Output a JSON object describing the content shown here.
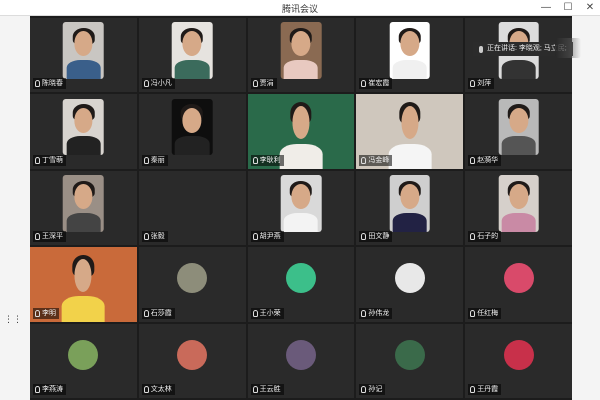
{
  "window": {
    "title": "腾讯会议",
    "controls": {
      "minimize": "—",
      "maximize": "☐",
      "close": "✕"
    }
  },
  "speaking_indicator": {
    "text": "正在讲话: 李晓观; 马立民;"
  },
  "side_control": {
    "label": "⋮⋮"
  },
  "participants": [
    {
      "name": "陈晓春",
      "kind": "camera",
      "bg": "#c9c6c2",
      "shirt": "#3a5f8a"
    },
    {
      "name": "冯小凡",
      "kind": "camera",
      "bg": "#e6e3df",
      "shirt": "#3b6b5c"
    },
    {
      "name": "贾涓",
      "kind": "camera",
      "bg": "#8a6a52",
      "shirt": "#e8c9c0"
    },
    {
      "name": "崔宏霞",
      "kind": "camera",
      "bg": "#ffffff",
      "shirt": "#f0f0f0"
    },
    {
      "name": "刘萍",
      "kind": "camera",
      "bg": "#dcdcdc",
      "shirt": "#333333"
    },
    {
      "name": "丁雪萌",
      "kind": "camera",
      "bg": "#d8d4cf",
      "shirt": "#222222"
    },
    {
      "name": "秦丽",
      "kind": "camera",
      "bg": "#0e0e0e",
      "shirt": "#222222"
    },
    {
      "name": "李耿利",
      "kind": "wide",
      "bg": "#2a6a4a",
      "shirt": "#f0ede8",
      "active": true
    },
    {
      "name": "冯金峰",
      "kind": "wide",
      "bg": "#cfc7bd",
      "shirt": "#f5f5f5"
    },
    {
      "name": "赵漪华",
      "kind": "camera",
      "bg": "#b9b9b9",
      "shirt": "#555555"
    },
    {
      "name": "王深平",
      "kind": "camera",
      "bg": "#9a8f86",
      "shirt": "#444444"
    },
    {
      "name": "张毅",
      "kind": "empty"
    },
    {
      "name": "胡尹燕",
      "kind": "camera",
      "bg": "#d9d9d9",
      "shirt": "#f3f3f3"
    },
    {
      "name": "田文静",
      "kind": "camera",
      "bg": "#cfcfcf",
      "shirt": "#222244"
    },
    {
      "name": "石子的",
      "kind": "camera",
      "bg": "#d6d0cb",
      "shirt": "#c98aa5"
    },
    {
      "name": "李明",
      "kind": "wide",
      "bg": "#c96a3a",
      "shirt": "#f2d24a"
    },
    {
      "name": "石莎霞",
      "kind": "avatar",
      "avatar": "#8d8d7a"
    },
    {
      "name": "王小荣",
      "kind": "avatar",
      "avatar": "#3cbf8a"
    },
    {
      "name": "孙伟龙",
      "kind": "avatar",
      "avatar": "#e8e8e8"
    },
    {
      "name": "任红梅",
      "kind": "avatar",
      "avatar": "#d94a6a"
    },
    {
      "name": "李燕涛",
      "kind": "avatar",
      "avatar": "#7aa05a"
    },
    {
      "name": "文太林",
      "kind": "avatar",
      "avatar": "#c96a5a"
    },
    {
      "name": "王云胜",
      "kind": "avatar",
      "avatar": "#6a5a7a"
    },
    {
      "name": "孙记",
      "kind": "avatar",
      "avatar": "#3a6a4a"
    },
    {
      "name": "王丹霞",
      "kind": "avatar",
      "avatar": "#c8304a"
    }
  ]
}
